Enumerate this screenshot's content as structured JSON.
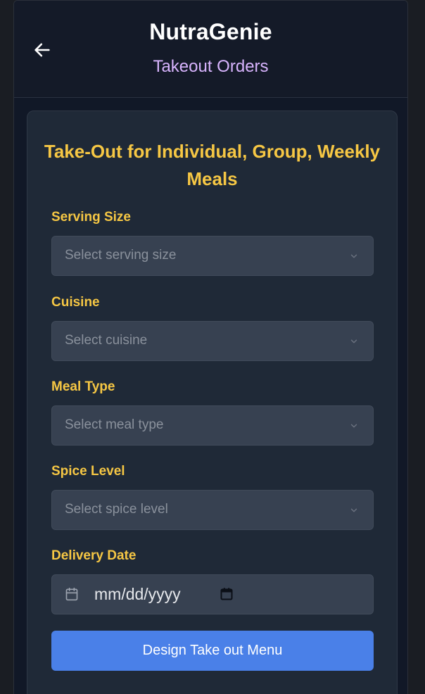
{
  "header": {
    "title": "NutraGenie",
    "subtitle": "Takeout Orders",
    "back_icon": "arrow-left-icon"
  },
  "form": {
    "title": "Take-Out for Individual, Group, Weekly Meals",
    "fields": [
      {
        "label": "Serving Size",
        "placeholder": "Select serving size"
      },
      {
        "label": "Cuisine",
        "placeholder": "Select cuisine"
      },
      {
        "label": "Meal Type",
        "placeholder": "Select meal type"
      },
      {
        "label": "Spice Level",
        "placeholder": "Select spice level"
      }
    ],
    "date": {
      "label": "Delivery Date",
      "placeholder": "mm/dd/yyyy"
    },
    "submit_label": "Design Take out Menu"
  },
  "colors": {
    "accent": "#f6c744",
    "subtitle": "#d8b4fe",
    "button": "#4a80e8"
  }
}
